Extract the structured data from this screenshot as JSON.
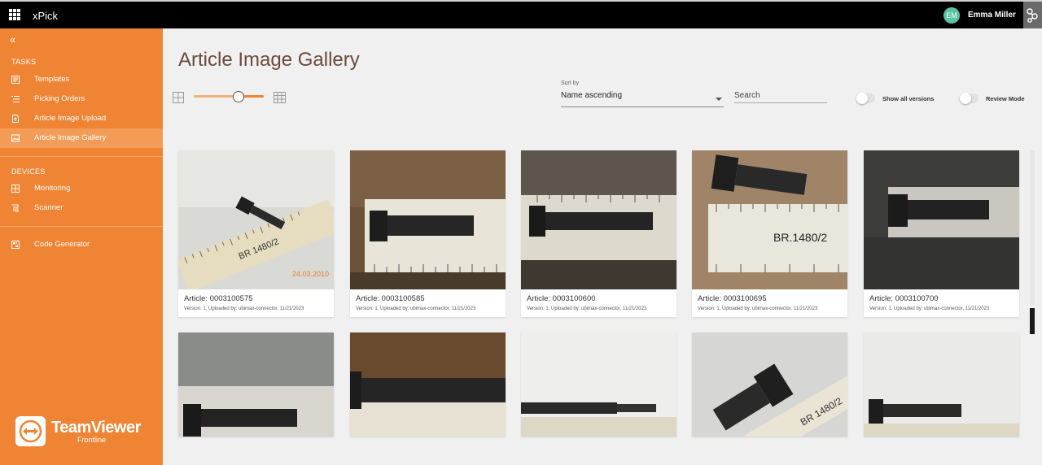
{
  "app": {
    "name": "xPick",
    "user_initials": "EM",
    "user_name": "Emma Miller"
  },
  "sidebar": {
    "sections": [
      {
        "label": "TASKS",
        "items": [
          {
            "label": "Templates",
            "icon": "templates-icon"
          },
          {
            "label": "Picking Orders",
            "icon": "list-icon"
          },
          {
            "label": "Article Image Upload",
            "icon": "upload-icon"
          },
          {
            "label": "Article Image Gallery",
            "icon": "gallery-icon",
            "active": true
          }
        ]
      },
      {
        "label": "DEVICES",
        "items": [
          {
            "label": "Monitoring",
            "icon": "grid-icon"
          },
          {
            "label": "Scanner",
            "icon": "scanner-icon"
          }
        ]
      },
      {
        "label": "",
        "items": [
          {
            "label": "Code Generator",
            "icon": "qr-icon"
          }
        ]
      }
    ],
    "logo": {
      "name": "TeamViewer",
      "subtitle": "Frontline"
    }
  },
  "page": {
    "title": "Article Image Gallery",
    "toolbar": {
      "size_slider_level": 0.6,
      "sort_label": "Sort by",
      "sort_value": "Name ascending",
      "search_placeholder": "Search",
      "show_all_versions_label": "Show all versions",
      "show_all_versions_on": false,
      "review_mode_label": "Review Mode",
      "review_mode_on": false
    }
  },
  "gallery": {
    "cards": [
      {
        "title": "Article: 0003100575",
        "meta": "Version: 1, Uploaded by: ubimax-connector, 11/21/2023"
      },
      {
        "title": "Article: 0003100585",
        "meta": "Version: 1, Uploaded by: ubimax-connector, 11/21/2023"
      },
      {
        "title": "Article: 0003100600",
        "meta": "Version: 1, Uploaded by: ubimax-connector, 11/21/2023"
      },
      {
        "title": "Article: 0003100695",
        "meta": "Version: 1, Uploaded by: ubimax-connector, 11/21/2023"
      },
      {
        "title": "Article: 0003100700",
        "meta": "Version: 1, Uploaded by: ubimax-connector, 11/21/2023"
      },
      {
        "title": "",
        "meta": ""
      },
      {
        "title": "",
        "meta": ""
      },
      {
        "title": "",
        "meta": ""
      },
      {
        "title": "",
        "meta": ""
      },
      {
        "title": "",
        "meta": ""
      }
    ],
    "photo_texts": {
      "ruler_label": "BR 1480/2",
      "ruler_label_alt": "BR.1480/2",
      "date_stamp": "24.03.2010"
    }
  },
  "colors": {
    "sidebar": "#ef8434",
    "sidebar_active": "#f39c57",
    "topbar": "#000000",
    "title": "#6b4a3c",
    "avatar": "#5bc2a4"
  }
}
